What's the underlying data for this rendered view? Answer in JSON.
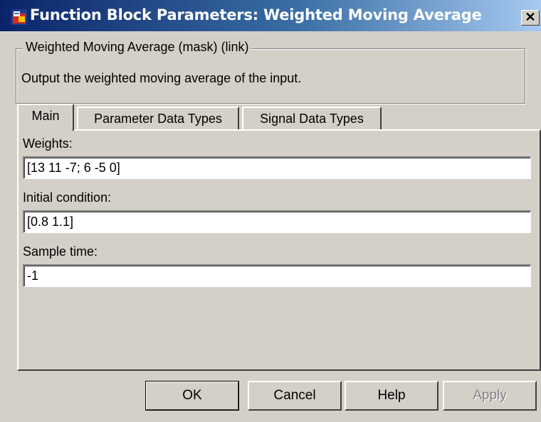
{
  "window": {
    "title": "Function Block Parameters: Weighted Moving Average",
    "close_glyph": "✕"
  },
  "description": {
    "legend": "Weighted Moving Average (mask) (link)",
    "text": "Output the weighted moving average of the input."
  },
  "tabs": [
    {
      "label": "Main",
      "active": true
    },
    {
      "label": "Parameter Data Types",
      "active": false
    },
    {
      "label": "Signal Data Types",
      "active": false
    }
  ],
  "fields": {
    "weights": {
      "label": "Weights:",
      "value": "[13 11 -7; 6 -5 0]"
    },
    "initial_condition": {
      "label": "Initial condition:",
      "value": "[0.8 1.1]"
    },
    "sample_time": {
      "label": "Sample time:",
      "value": "-1"
    }
  },
  "buttons": {
    "ok": "OK",
    "cancel": "Cancel",
    "help": "Help",
    "apply": "Apply"
  },
  "colors": {
    "titlebar_start": "#0a246a",
    "titlebar_end": "#a6caf0",
    "dialog_face": "#d4d0c8"
  },
  "icons": {
    "app": "simulink-block-icon",
    "close": "close-icon"
  }
}
